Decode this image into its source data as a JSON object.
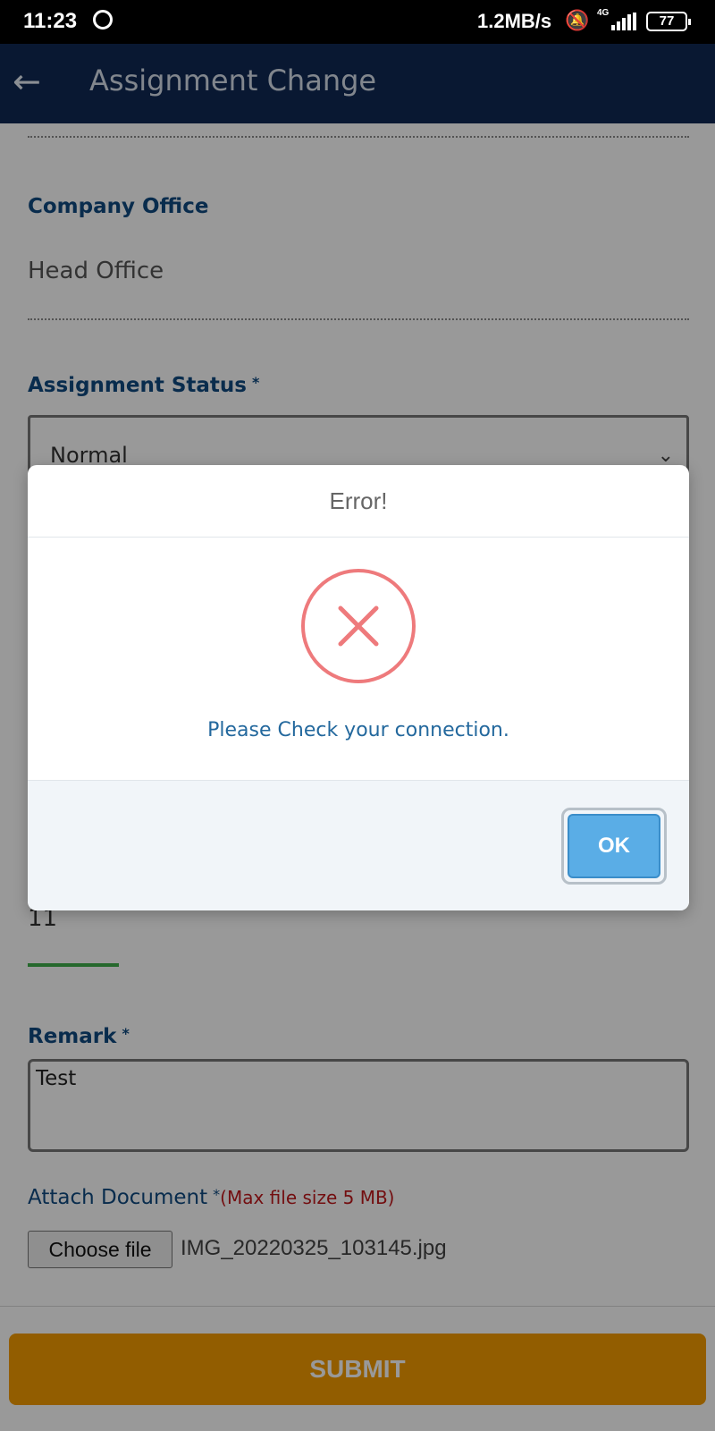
{
  "status_bar": {
    "time": "11:23",
    "speed": "1.2MB/s",
    "network": "4G",
    "battery": "77",
    "icons": [
      "whatsapp-icon",
      "mute-icon",
      "signal-icon",
      "battery-icon"
    ]
  },
  "app_bar": {
    "title": "Assignment Change",
    "back_icon": "arrow-left-icon"
  },
  "form": {
    "company_office_label": "Company Office",
    "company_office_value": "Head Office",
    "assignment_status_label": "Assignment Status",
    "assignment_status_value": "Normal",
    "required_mark": "*",
    "hours_value": "11",
    "remark_label": "Remark",
    "remark_value": "Test",
    "attach_label": "Attach Document",
    "attach_hint": "(Max file size 5 MB)",
    "choose_file_label": "Choose file",
    "file_name": "IMG_20220325_103145.jpg",
    "submit_label": "SUBMIT"
  },
  "dialog": {
    "title": "Error!",
    "icon": "error-x-icon",
    "message": "Please Check your connection.",
    "ok_label": "OK",
    "colors": {
      "error": "#ee7a7c",
      "ok_button": "#5aade6",
      "message": "#23689d"
    }
  },
  "colors": {
    "app_bar": "#0f2954",
    "label": "#0f4a80",
    "submit": "#f49c00",
    "hint_red": "#c0181c"
  }
}
